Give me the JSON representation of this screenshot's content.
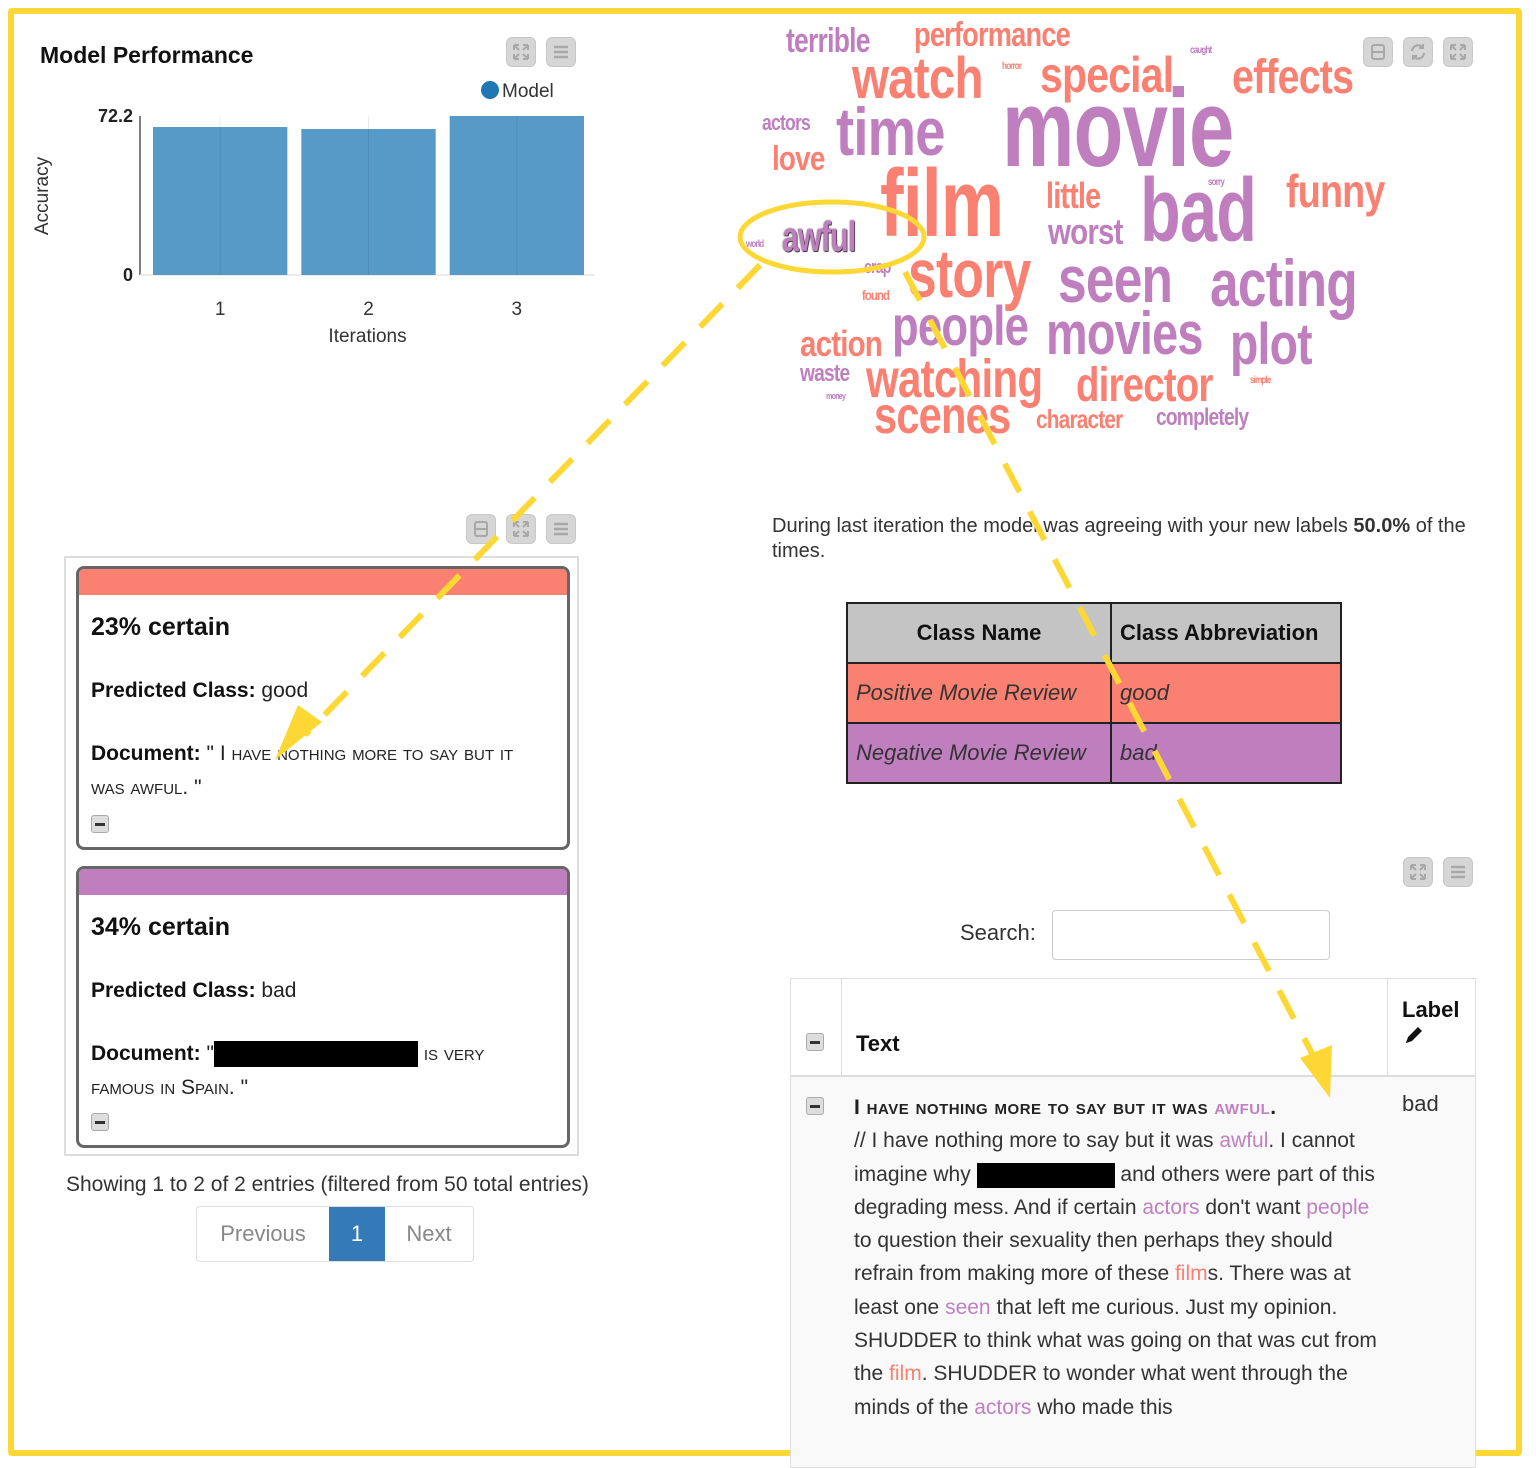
{
  "colors": {
    "good": "#fa8072",
    "bad": "#bf7fbf",
    "bar": "#5799c7",
    "legend_dot": "#1f77b4",
    "frame": "#fdd835",
    "pager_active": "#337ab7"
  },
  "chart_panel": {
    "title": "Model Performance",
    "toolbar": [
      "expand-icon",
      "menu-icon"
    ]
  },
  "chart_data": {
    "type": "bar",
    "title": "Model Performance",
    "categories": [
      "1",
      "2",
      "3"
    ],
    "series": [
      {
        "name": "Model",
        "values": [
          67.2,
          66.3,
          72.2
        ]
      }
    ],
    "xlabel": "Iterations",
    "ylabel": "Accuracy",
    "ylim": [
      0,
      72.2
    ],
    "yticks": [
      "0",
      "72.2"
    ],
    "legend": "top-right",
    "grid": false
  },
  "wordcloud": {
    "toolbar": [
      "collapse-icon",
      "refresh-icon",
      "expand-icon"
    ],
    "words": [
      {
        "text": "terrible",
        "cls": "bad"
      },
      {
        "text": "performance",
        "cls": "good"
      },
      {
        "text": "watch",
        "cls": "good"
      },
      {
        "text": "horror",
        "cls": "good"
      },
      {
        "text": "special",
        "cls": "good"
      },
      {
        "text": "caught",
        "cls": "bad"
      },
      {
        "text": "effects",
        "cls": "good"
      },
      {
        "text": "actors",
        "cls": "bad"
      },
      {
        "text": "time",
        "cls": "bad"
      },
      {
        "text": "movie",
        "cls": "bad"
      },
      {
        "text": "love",
        "cls": "good"
      },
      {
        "text": "film",
        "cls": "good"
      },
      {
        "text": "little",
        "cls": "good"
      },
      {
        "text": "sorry",
        "cls": "bad"
      },
      {
        "text": "bad",
        "cls": "bad"
      },
      {
        "text": "funny",
        "cls": "good"
      },
      {
        "text": "world",
        "cls": "bad"
      },
      {
        "text": "awful",
        "cls": "bad"
      },
      {
        "text": "worst",
        "cls": "bad"
      },
      {
        "text": "crap",
        "cls": "bad"
      },
      {
        "text": "found",
        "cls": "good"
      },
      {
        "text": "story",
        "cls": "good"
      },
      {
        "text": "seen",
        "cls": "bad"
      },
      {
        "text": "acting",
        "cls": "bad"
      },
      {
        "text": "action",
        "cls": "good"
      },
      {
        "text": "people",
        "cls": "bad"
      },
      {
        "text": "movies",
        "cls": "bad"
      },
      {
        "text": "plot",
        "cls": "bad"
      },
      {
        "text": "waste",
        "cls": "bad"
      },
      {
        "text": "money",
        "cls": "bad"
      },
      {
        "text": "watching",
        "cls": "good"
      },
      {
        "text": "director",
        "cls": "good"
      },
      {
        "text": "simple",
        "cls": "good"
      },
      {
        "text": "scenes",
        "cls": "good"
      },
      {
        "text": "character",
        "cls": "good"
      },
      {
        "text": "completely",
        "cls": "bad"
      }
    ]
  },
  "uncertain_panel": {
    "toolbar": [
      "collapse-icon",
      "expand-icon",
      "menu-icon"
    ],
    "cards": [
      {
        "certainty": "23% certain",
        "predicted_label": "Predicted Class:",
        "predicted_value": "good",
        "document_label": "Document:",
        "document_open": "\"",
        "document_text": "I have nothing more to say but it was awful.",
        "document_close": "\"",
        "cls": "good"
      },
      {
        "certainty": "34% certain",
        "predicted_label": "Predicted Class:",
        "predicted_value": "bad",
        "document_label": "Document:",
        "document_open": "\"",
        "document_text": "is very famous in Spain.",
        "document_close": "\"",
        "cls": "bad",
        "redacted": true
      }
    ],
    "showing": "Showing 1 to 2 of 2 entries (filtered from 50 total entries)",
    "pagination": {
      "previous": "Previous",
      "current": "1",
      "next": "Next"
    }
  },
  "agreement": {
    "text_before": "During last iteration the model was agreeing with your new labels ",
    "percent": "50.0%",
    "text_after": " of the times."
  },
  "class_table": {
    "headers": [
      "Class Name",
      "Class Abbreviation"
    ],
    "rows": [
      {
        "name": "Positive Movie Review",
        "abbr": "good",
        "cls": "good"
      },
      {
        "name": "Negative Movie Review",
        "abbr": "bad",
        "cls": "bad"
      }
    ]
  },
  "labeled_table": {
    "toolbar": [
      "expand-icon",
      "menu-icon"
    ],
    "search_label": "Search:",
    "search_value": "",
    "headers": {
      "text": "Text",
      "label": "Label"
    },
    "row": {
      "title_before": "I have nothing more to say but it was ",
      "title_hl": "awful",
      "title_after": ".",
      "label": "bad",
      "body": [
        {
          "t": "// I have nothing more to say but it was "
        },
        {
          "t": "awful",
          "hl": "bad"
        },
        {
          "t": ". I cannot imagine why "
        },
        {
          "redact": true
        },
        {
          "t": " and others were part of this degrading mess. And if certain "
        },
        {
          "t": "actors",
          "hl": "bad"
        },
        {
          "t": " don't want "
        },
        {
          "t": "people",
          "hl": "bad"
        },
        {
          "t": " to question their sexuality then perhaps they should refrain from making more of these "
        },
        {
          "t": "film",
          "hl": "good"
        },
        {
          "t": "s. There was at least one "
        },
        {
          "t": "seen",
          "hl": "bad"
        },
        {
          "t": " that left me curious. Just my opinion. SHUDDER to think what was going on that was cut from the "
        },
        {
          "t": "film",
          "hl": "good"
        },
        {
          "t": ". SHUDDER to wonder what went through the minds of the "
        },
        {
          "t": "actors",
          "hl": "bad"
        },
        {
          "t": " who made this"
        }
      ]
    }
  }
}
